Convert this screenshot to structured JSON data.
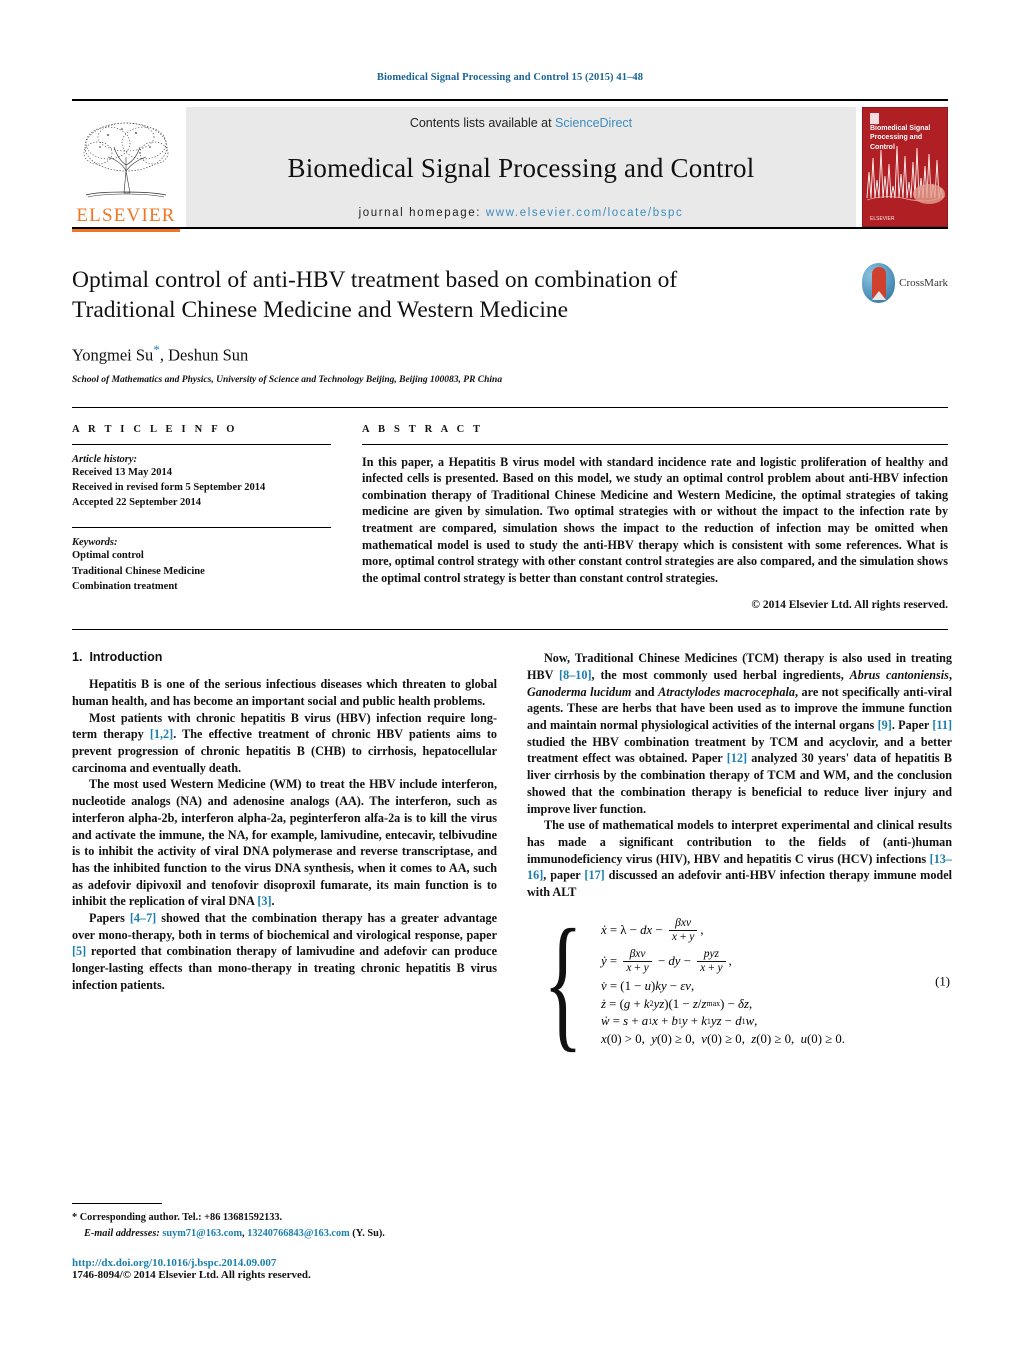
{
  "running_head": "Biomedical Signal Processing and Control 15 (2015) 41–48",
  "masthead": {
    "contents_prefix": "Contents lists available at ",
    "sciencedirect": "ScienceDirect",
    "journal_title": "Biomedical Signal Processing and Control",
    "homepage_prefix": "journal homepage:",
    "homepage_url": "www.elsevier.com/locate/bspc",
    "publisher_wordmark": "ELSEVIER",
    "cover_title": "Biomedical Signal Processing and Control",
    "cover_publisher": "ELSEVIER"
  },
  "article": {
    "title": "Optimal control of anti-HBV treatment based on combination of Traditional Chinese Medicine and Western Medicine",
    "authors": "Yongmei Su",
    "authors_rest": ", Deshun Sun",
    "corresponding_marker": "*",
    "affiliation": "School of Mathematics and Physics, University of Science and Technology Beijing, Beijing 100083, PR China",
    "crossmark_label": "CrossMark"
  },
  "info": {
    "heading": "A R T I C L E   I N F O",
    "history_label": "Article history:",
    "history": [
      "Received 13 May 2014",
      "Received in revised form 5 September 2014",
      "Accepted 22 September 2014"
    ],
    "keywords_label": "Keywords:",
    "keywords": [
      "Optimal control",
      "Traditional Chinese Medicine",
      "Combination treatment"
    ]
  },
  "abstract": {
    "heading": "A B S T R A C T",
    "text": "In this paper, a Hepatitis B virus model with standard incidence rate and logistic proliferation of healthy and infected cells is presented. Based on this model, we study an optimal control problem about anti-HBV infection combination therapy of Traditional Chinese Medicine and Western Medicine, the optimal strategies of taking medicine are given by simulation. Two optimal strategies with or without the impact to the infection rate by treatment are compared, simulation shows the impact to the reduction of infection may be omitted when mathematical model is used to study the anti-HBV therapy which is consistent with some references. What is more, optimal control strategy with other constant control strategies are also compared, and the simulation shows the optimal control strategy is better than constant control strategies.",
    "copyright": "© 2014 Elsevier Ltd. All rights reserved."
  },
  "body": {
    "section_number": "1.",
    "section_title": "Introduction",
    "left_paragraphs": [
      {
        "parts": [
          {
            "t": "Hepatitis B is one of the serious infectious diseases which threaten to global human health, and has become an important social and public health problems."
          }
        ]
      },
      {
        "parts": [
          {
            "t": "Most patients with chronic hepatitis B virus (HBV) infection require long-term therapy "
          },
          {
            "t": "[1,2]",
            "k": "ref"
          },
          {
            "t": ". The effective treatment of chronic HBV patients aims to prevent progression of chronic hepatitis B (CHB) to cirrhosis, hepatocellular carcinoma and eventually death."
          }
        ]
      },
      {
        "parts": [
          {
            "t": "The most used Western Medicine (WM) to treat the HBV include interferon, nucleotide analogs (NA) and adenosine analogs (AA). The interferon, such as interferon alpha-2b, interferon alpha-2a, peginterferon alfa-2a is to kill the virus and activate the immune, the NA, for example, lamivudine, entecavir, telbivudine is to inhibit the activity of viral DNA polymerase and reverse transcriptase, and has the inhibited function to the virus DNA synthesis, when it comes to AA, such as adefovir dipivoxil and tenofovir disoproxil fumarate, its main function is to inhibit the replication of viral DNA "
          },
          {
            "t": "[3]",
            "k": "ref"
          },
          {
            "t": "."
          }
        ]
      },
      {
        "parts": [
          {
            "t": "Papers "
          },
          {
            "t": "[4–7]",
            "k": "ref"
          },
          {
            "t": " showed that the combination therapy has a greater advantage over mono-therapy, both in terms of biochemical and virological response, paper "
          },
          {
            "t": "[5]",
            "k": "ref"
          },
          {
            "t": " reported that combination therapy of lamivudine and adefovir can produce longer-lasting effects than mono-therapy in treating chronic hepatitis B virus infection patients."
          }
        ]
      }
    ],
    "right_paragraphs": [
      {
        "parts": [
          {
            "t": "Now, Traditional Chinese Medicines (TCM) therapy is also used in treating HBV "
          },
          {
            "t": "[8–10]",
            "k": "ref"
          },
          {
            "t": ", the most commonly used herbal ingredients, "
          },
          {
            "t": "Abrus cantoniensis",
            "k": "it"
          },
          {
            "t": ", "
          },
          {
            "t": "Ganoderma lucidum",
            "k": "it"
          },
          {
            "t": " and "
          },
          {
            "t": "Atractylodes macrocephala",
            "k": "it"
          },
          {
            "t": ", are not specifically anti-viral agents. These are herbs that have been used as to improve the immune function and maintain normal physiological activities of the internal organs "
          },
          {
            "t": "[9]",
            "k": "ref"
          },
          {
            "t": ". Paper "
          },
          {
            "t": "[11]",
            "k": "ref"
          },
          {
            "t": " studied the HBV combination treatment by TCM and acyclovir, and a better treatment effect was obtained. Paper "
          },
          {
            "t": "[12]",
            "k": "ref"
          },
          {
            "t": " analyzed 30 years' data of hepatitis B liver cirrhosis by the combination therapy of TCM and WM, and the conclusion showed that the combination therapy is beneficial to reduce liver injury and improve liver function."
          }
        ]
      },
      {
        "parts": [
          {
            "t": "The use of mathematical models to interpret experimental and clinical results has made a significant contribution to the fields of (anti-)human immunodeficiency virus (HIV), HBV and hepatitis C virus (HCV) infections "
          },
          {
            "t": "[13–16]",
            "k": "ref"
          },
          {
            "t": ", paper "
          },
          {
            "t": "[17]",
            "k": "ref"
          },
          {
            "t": " discussed an adefovir anti-HBV infection therapy immune model with ALT"
          }
        ]
      }
    ]
  },
  "equation": {
    "number": "(1)",
    "lines": [
      "ẋ = λ − dx − βxv/(x+y),",
      "ẏ = βxv/(x+y) − dy − pyz/(x+y),",
      "v̇ = (1 − u)ky − εv,",
      "ż = (g + k₂yz)(1 − z/z_max) − δz,",
      "ẇ = s + a₁x + b₁y + k₁yz − d₁w,",
      "x(0) > 0,  y(0) ≥ 0,  v(0) ≥ 0,  z(0) ≥ 0,  u(0) ≥ 0."
    ]
  },
  "footnotes": {
    "corresponding": "* Corresponding author. Tel.: +86 13681592133.",
    "email_label": "E-mail addresses:",
    "email1": "suym71@163.com",
    "email_sep": ", ",
    "email2": "13240766843@163.com",
    "email_suffix": " (Y. Su).",
    "doi": "http://dx.doi.org/10.1016/j.bspc.2014.09.007",
    "issn": "1746-8094/© 2014 Elsevier Ltd. All rights reserved."
  },
  "colors": {
    "link": "#1a7fae",
    "header_blue": "#1a6496",
    "elsevier_orange": "#ef7622",
    "cover_red": "#b01f24"
  }
}
